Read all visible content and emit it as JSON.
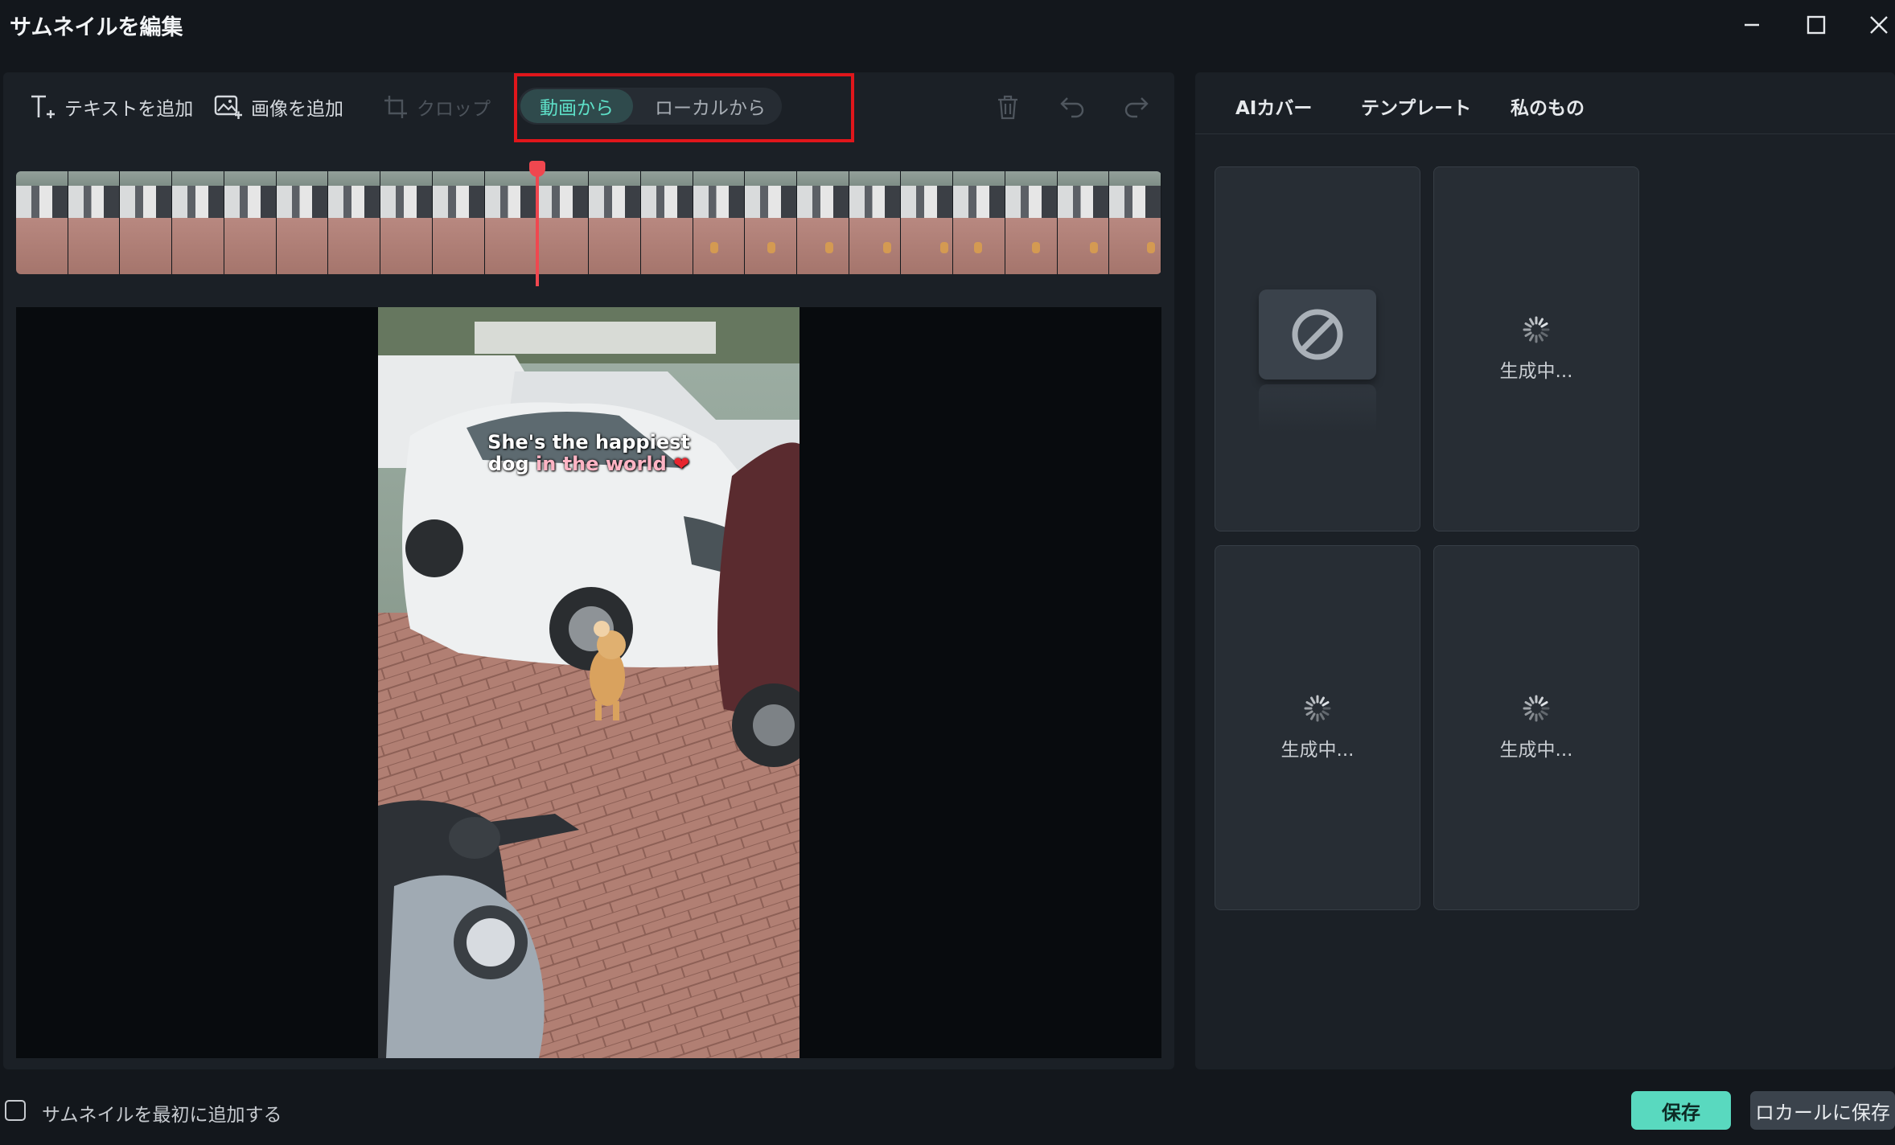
{
  "window": {
    "title": "サムネイルを編集"
  },
  "toolbar": {
    "add_text_label": "テキストを追加",
    "add_image_label": "画像を追加",
    "crop_label": "クロップ",
    "source_from_video": "動画から",
    "source_from_local": "ローカルから",
    "selected_source": "動画から"
  },
  "preview": {
    "caption_line1": "She's the happiest",
    "caption_line2_a": "dog ",
    "caption_line2_b": "in the world",
    "caption_heart": "❤"
  },
  "right_panel": {
    "tabs": [
      {
        "label": "AIカバー"
      },
      {
        "label": "テンプレート"
      },
      {
        "label": "私のもの"
      }
    ],
    "cards": [
      {
        "state": "none"
      },
      {
        "state": "generating",
        "label": "生成中..."
      },
      {
        "state": "generating",
        "label": "生成中..."
      },
      {
        "state": "generating",
        "label": "生成中..."
      }
    ]
  },
  "footer": {
    "add_first_checkbox_label": "サムネイルを最初に追加する",
    "add_first_checked": false,
    "save_label": "保存",
    "save_local_label": "ロカールに保存"
  },
  "colors": {
    "accent": "#59d9bf",
    "playhead": "#f0474f",
    "highlight_box": "#e0161b"
  }
}
